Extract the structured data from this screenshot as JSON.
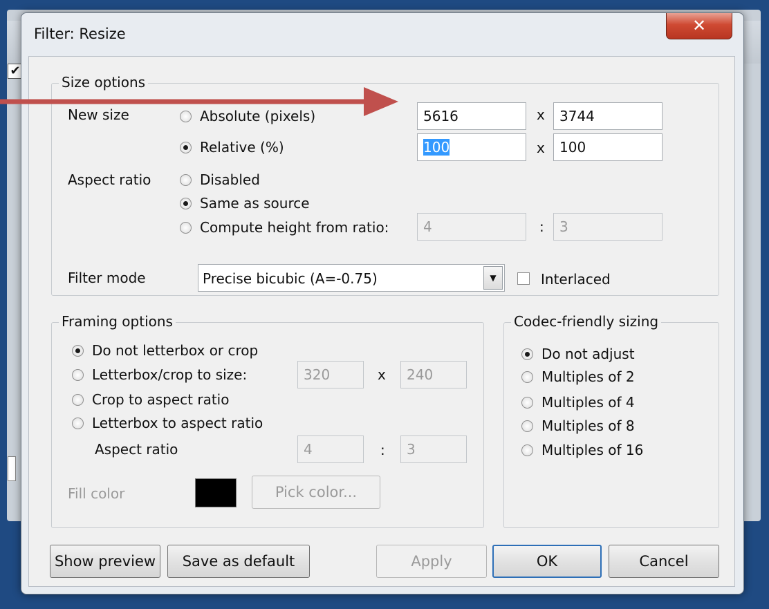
{
  "background": {
    "checkbox_glyph": "✔"
  },
  "dialog": {
    "title": "Filter: Resize",
    "close_glyph": "✕"
  },
  "size_options": {
    "legend": "Size options",
    "new_size_label": "New size",
    "absolute_label": "Absolute (pixels)",
    "absolute_width": "5616",
    "absolute_height": "3744",
    "relative_label": "Relative (%)",
    "relative_width": "100",
    "relative_height": "100",
    "times": "x",
    "aspect_ratio_label": "Aspect ratio",
    "aspect_disabled": "Disabled",
    "aspect_same": "Same as source",
    "aspect_compute": "Compute height from ratio:",
    "ratio_w": "4",
    "ratio_sep": ":",
    "ratio_h": "3",
    "filter_mode_label": "Filter mode",
    "filter_mode_value": "Precise bicubic (A=-0.75)",
    "interlaced_label": "Interlaced"
  },
  "framing_options": {
    "legend": "Framing options",
    "no_letterbox": "Do not letterbox or crop",
    "letterbox_crop": "Letterbox/crop to size:",
    "lb_width": "320",
    "times": "x",
    "lb_height": "240",
    "crop_aspect": "Crop to aspect ratio",
    "letterbox_aspect": "Letterbox to aspect ratio",
    "aspect_ratio_label": "Aspect ratio",
    "ar_w": "4",
    "ar_sep": ":",
    "ar_h": "3",
    "fill_color_label": "Fill color",
    "fill_color": "#000000",
    "pick_color_label": "Pick color..."
  },
  "codec_sizing": {
    "legend": "Codec-friendly sizing",
    "options": [
      "Do not adjust",
      "Multiples of 2",
      "Multiples of 4",
      "Multiples of 8",
      "Multiples of 16"
    ]
  },
  "buttons": {
    "show_preview": "Show preview",
    "save_default": "Save as default",
    "apply": "Apply",
    "ok": "OK",
    "cancel": "Cancel"
  },
  "annotation": {
    "arrow_color": "#c0504d"
  }
}
